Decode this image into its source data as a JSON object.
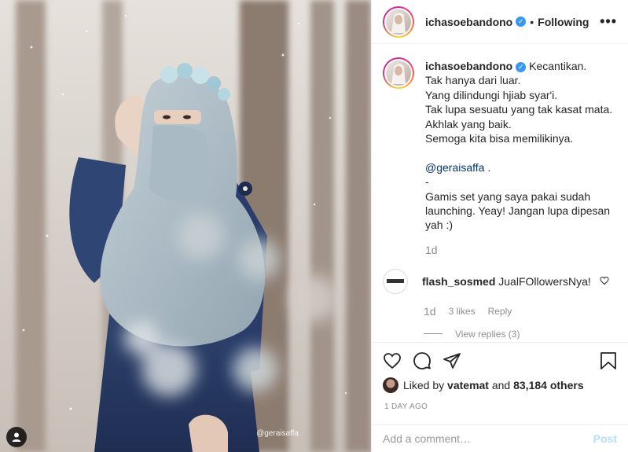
{
  "photo": {
    "watermark": "@geraisaffa",
    "colors": {
      "scarf": "#a9b9c3",
      "dress": "#2c3f66",
      "background": "#d3ccc6",
      "tree": "#8d7f74"
    }
  },
  "header": {
    "username": "ichasoebandono",
    "separator": "•",
    "follow_status": "Following",
    "more_icon": "ellipsis-icon",
    "verified_icon": "verified-badge-icon"
  },
  "caption": {
    "username": "ichasoebandono",
    "lines": [
      "Kecantikan.",
      "Tak hanya dari luar.",
      "Yang dilindungi hjiab syar'i.",
      "Tak lupa sesuatu yang tak kasat mata.",
      "Akhlak yang baik.",
      "Semoga kita bisa memilikinya.",
      "",
      "@geraisaffa .",
      "-",
      "Gamis set yang saya pakai sudah",
      "launching. Yeay! Jangan lupa dipesan",
      "yah :)"
    ],
    "time": "1d"
  },
  "comment": {
    "username": "flash_sosmed",
    "text": "JualFOllowersNya!",
    "time": "1d",
    "likes": "3 likes",
    "reply_label": "Reply",
    "view_replies": "View replies (3)"
  },
  "actions": {
    "like_icon": "heart-icon",
    "comment_icon": "comment-bubble-icon",
    "share_icon": "paper-plane-icon",
    "save_icon": "bookmark-icon"
  },
  "likes": {
    "prefix": "Liked by",
    "user": "vatemat",
    "middle": "and",
    "count": "83,184 others"
  },
  "post_date": "1 DAY AGO",
  "comment_box": {
    "placeholder": "Add a comment…",
    "post_label": "Post"
  },
  "accent_color": "#3897f0"
}
